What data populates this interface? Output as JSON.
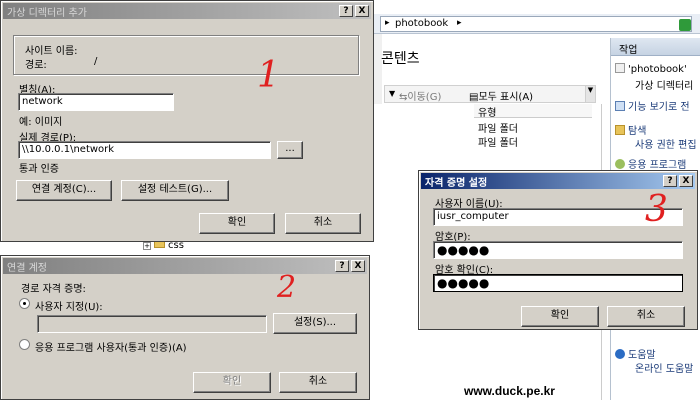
{
  "background": {
    "breadcrumb": "photobook",
    "content_title": "콘텐츠",
    "toolbar": {
      "move": "이동(G)",
      "show_all": "모두 표시(A)"
    },
    "list": {
      "column_type": "유형",
      "rows": [
        "파일 폴더",
        "파일 폴더"
      ]
    },
    "tree_item": "css",
    "actions": {
      "header": "작업",
      "items": [
        "'photobook'",
        "가상 디렉터리",
        "기능 보기로 전",
        "탐색",
        "사용 권한 편집",
        "응용 프로그램",
        "도움말",
        "온라인 도움말"
      ]
    }
  },
  "dialog1": {
    "title": "가상 디렉터리 추가",
    "site_name_label": "사이트 이름:",
    "site_name_value": "",
    "path_label": "경로:",
    "path_value": "/",
    "alias_label": "별칭(A):",
    "alias_value": "network",
    "example_label": "예: 이미지",
    "physical_path_label": "실제 경로(P):",
    "physical_path_value": "\\\\10.0.0.1\\network",
    "browse_button": "...",
    "pass_through_label": "통과 인증",
    "connect_as_button": "연결 계정(C)...",
    "test_settings_button": "설정 테스트(G)...",
    "ok_button": "확인",
    "cancel_button": "취소",
    "help_button": "?",
    "close_button": "X",
    "annotation": "1"
  },
  "dialog2": {
    "title": "연결 계정",
    "path_credentials_label": "경로 자격 증명:",
    "specific_user_label": "사용자 지정(U):",
    "specific_user_value": "",
    "set_button": "설정(S)...",
    "app_user_label": "응용 프로그램 사용자(통과 인증)(A)",
    "ok_button": "확인",
    "cancel_button": "취소",
    "help_button": "?",
    "close_button": "X",
    "annotation": "2"
  },
  "dialog3": {
    "title": "자격 증명 설정",
    "username_label": "사용자 이름(U):",
    "username_value": "iusr_computer",
    "password_label": "암호(P):",
    "password_value": "●●●●●",
    "confirm_label": "암호 확인(C):",
    "confirm_value": "●●●●●",
    "ok_button": "확인",
    "cancel_button": "취소",
    "help_button": "?",
    "close_button": "X",
    "annotation": "3"
  },
  "watermark": "www.duck.pe.kr",
  "colors": {
    "active_title": "#0a246a",
    "dialog_face": "#d4d0c8",
    "annotation": "#e02020"
  }
}
